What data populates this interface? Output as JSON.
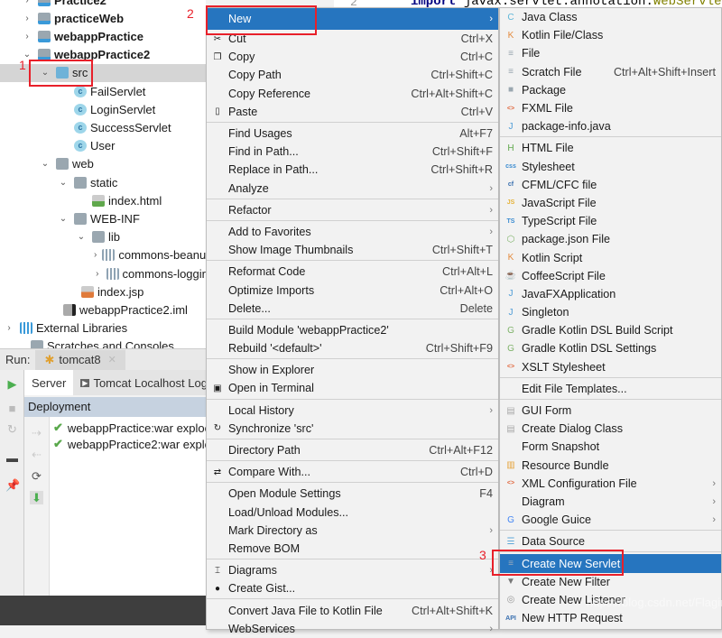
{
  "editor": {
    "line_number": "2",
    "code_keyword": "import",
    "code_package": " javax.servlet.annotation.",
    "code_class": "WebServlet",
    "code_end": ";"
  },
  "tree": {
    "items": [
      {
        "label": "Practice2",
        "depth": 1,
        "arrow": "›",
        "icon": "mod",
        "bold": true
      },
      {
        "label": "practiceWeb",
        "depth": 1,
        "arrow": "›",
        "icon": "mod",
        "bold": true
      },
      {
        "label": "webappPractice",
        "depth": 1,
        "arrow": "›",
        "icon": "mod",
        "bold": true
      },
      {
        "label": "webappPractice2",
        "depth": 1,
        "arrow": "⌄",
        "icon": "mod",
        "bold": true
      },
      {
        "label": "src",
        "depth": 2,
        "arrow": "⌄",
        "icon": "srcf",
        "selected": true
      },
      {
        "label": "FailServlet",
        "depth": 3,
        "arrow": "",
        "icon": "cls"
      },
      {
        "label": "LoginServlet",
        "depth": 3,
        "arrow": "",
        "icon": "cls"
      },
      {
        "label": "SuccessServlet",
        "depth": 3,
        "arrow": "",
        "icon": "cls"
      },
      {
        "label": "User",
        "depth": 3,
        "arrow": "",
        "icon": "cls"
      },
      {
        "label": "web",
        "depth": 2,
        "arrow": "⌄",
        "icon": "folder"
      },
      {
        "label": "static",
        "depth": 3,
        "arrow": "⌄",
        "icon": "folder"
      },
      {
        "label": "index.html",
        "depth": 4,
        "arrow": "",
        "icon": "html"
      },
      {
        "label": "WEB-INF",
        "depth": 3,
        "arrow": "⌄",
        "icon": "folder"
      },
      {
        "label": "lib",
        "depth": 4,
        "arrow": "⌄",
        "icon": "folder"
      },
      {
        "label": "commons-beanu",
        "depth": 5,
        "arrow": "›",
        "icon": "jar"
      },
      {
        "label": "commons-loggir",
        "depth": 5,
        "arrow": "›",
        "icon": "jar"
      },
      {
        "label": "index.jsp",
        "depth": 3.4,
        "arrow": "",
        "icon": "jsp"
      },
      {
        "label": "webappPractice2.iml",
        "depth": 2.4,
        "arrow": "",
        "icon": "iml"
      },
      {
        "label": "External Libraries",
        "depth": 0,
        "arrow": "›",
        "icon": "lib"
      },
      {
        "label": "Scratches and Consoles",
        "depth": 0.6,
        "arrow": "",
        "icon": "folder"
      }
    ]
  },
  "run": {
    "label": "Run:",
    "tab": "tomcat8",
    "subtabs": [
      "Server",
      "Tomcat Localhost Log"
    ],
    "deployment_header": "Deployment",
    "deployments": [
      "webappPractice:war exploc",
      "webappPractice2:war explo"
    ]
  },
  "context_menu": {
    "items": [
      {
        "label": "New",
        "shortcut": "",
        "submenu": true,
        "highlighted": true
      },
      {
        "label": "Cut",
        "shortcut": "Ctrl+X",
        "icon": "scissors-icon",
        "glyph": "✂"
      },
      {
        "label": "Copy",
        "shortcut": "Ctrl+C",
        "icon": "copy-icon",
        "glyph": "❐"
      },
      {
        "label": "Copy Path",
        "shortcut": "Ctrl+Shift+C"
      },
      {
        "label": "Copy Reference",
        "shortcut": "Ctrl+Alt+Shift+C"
      },
      {
        "label": "Paste",
        "shortcut": "Ctrl+V",
        "icon": "clipboard-icon",
        "glyph": "▯"
      },
      {
        "sep": true
      },
      {
        "label": "Find Usages",
        "shortcut": "Alt+F7"
      },
      {
        "label": "Find in Path...",
        "shortcut": "Ctrl+Shift+F"
      },
      {
        "label": "Replace in Path...",
        "shortcut": "Ctrl+Shift+R"
      },
      {
        "label": "Analyze",
        "submenu": true
      },
      {
        "sep": true
      },
      {
        "label": "Refactor",
        "submenu": true
      },
      {
        "sep": true
      },
      {
        "label": "Add to Favorites",
        "submenu": true
      },
      {
        "label": "Show Image Thumbnails",
        "shortcut": "Ctrl+Shift+T"
      },
      {
        "sep": true
      },
      {
        "label": "Reformat Code",
        "shortcut": "Ctrl+Alt+L"
      },
      {
        "label": "Optimize Imports",
        "shortcut": "Ctrl+Alt+O"
      },
      {
        "label": "Delete...",
        "shortcut": "Delete"
      },
      {
        "sep": true
      },
      {
        "label": "Build Module 'webappPractice2'"
      },
      {
        "label": "Rebuild '<default>'",
        "shortcut": "Ctrl+Shift+F9"
      },
      {
        "sep": true
      },
      {
        "label": "Show in Explorer"
      },
      {
        "label": "Open in Terminal",
        "icon": "terminal-icon",
        "glyph": "▣"
      },
      {
        "sep": true
      },
      {
        "label": "Local History",
        "submenu": true
      },
      {
        "label": "Synchronize 'src'",
        "icon": "sync-icon",
        "glyph": "↻"
      },
      {
        "sep": true
      },
      {
        "label": "Directory Path",
        "shortcut": "Ctrl+Alt+F12"
      },
      {
        "sep": true
      },
      {
        "label": "Compare With...",
        "shortcut": "Ctrl+D",
        "icon": "compare-icon",
        "glyph": "⇄"
      },
      {
        "sep": true
      },
      {
        "label": "Open Module Settings",
        "shortcut": "F4"
      },
      {
        "label": "Load/Unload Modules..."
      },
      {
        "label": "Mark Directory as",
        "submenu": true
      },
      {
        "label": "Remove BOM"
      },
      {
        "sep": true
      },
      {
        "label": "Diagrams",
        "submenu": true,
        "icon": "diagram-icon",
        "glyph": "⌶"
      },
      {
        "label": "Create Gist...",
        "icon": "github-icon",
        "glyph": "●"
      },
      {
        "sep": true
      },
      {
        "label": "Convert Java File to Kotlin File",
        "shortcut": "Ctrl+Alt+Shift+K"
      },
      {
        "label": "WebServices",
        "submenu": true
      }
    ]
  },
  "new_submenu": {
    "items": [
      {
        "label": "Java Class",
        "icon": "java-class-icon",
        "glyph": "C",
        "color": "#5fb7d9"
      },
      {
        "label": "Kotlin File/Class",
        "icon": "kotlin-icon",
        "glyph": "K",
        "color": "#e38a3d"
      },
      {
        "label": "File",
        "icon": "file-icon",
        "glyph": "≡",
        "color": "#9aa7b0"
      },
      {
        "label": "Scratch File",
        "shortcut": "Ctrl+Alt+Shift+Insert",
        "icon": "scratch-file-icon",
        "glyph": "≡",
        "color": "#9aa7b0"
      },
      {
        "label": "Package",
        "icon": "package-icon",
        "glyph": "■",
        "color": "#9aa7b0"
      },
      {
        "label": "FXML File",
        "icon": "fxml-icon",
        "glyph": "<>",
        "color": "#e0643a"
      },
      {
        "label": "package-info.java",
        "icon": "package-info-icon",
        "glyph": "J",
        "color": "#4a9ad6"
      },
      {
        "sep": true
      },
      {
        "label": "HTML File",
        "icon": "html-icon",
        "glyph": "H",
        "color": "#60a84c"
      },
      {
        "label": "Stylesheet",
        "icon": "css-icon",
        "glyph": "css",
        "color": "#3a8bd0"
      },
      {
        "label": "CFML/CFC file",
        "icon": "cfml-icon",
        "glyph": "cf",
        "color": "#3a70b0"
      },
      {
        "label": "JavaScript File",
        "icon": "javascript-icon",
        "glyph": "JS",
        "color": "#e5b33a"
      },
      {
        "label": "TypeScript File",
        "icon": "typescript-icon",
        "glyph": "TS",
        "color": "#3a8bd0"
      },
      {
        "label": "package.json File",
        "icon": "nodejs-icon",
        "glyph": "⬡",
        "color": "#7fb36a"
      },
      {
        "label": "Kotlin Script",
        "icon": "kotlin-script-icon",
        "glyph": "K",
        "color": "#e38a3d"
      },
      {
        "label": "CoffeeScript File",
        "icon": "coffeescript-icon",
        "glyph": "☕",
        "color": "#3a8bd0"
      },
      {
        "label": "JavaFXApplication",
        "icon": "javafx-icon",
        "glyph": "J",
        "color": "#4a9ad6"
      },
      {
        "label": "Singleton",
        "icon": "singleton-icon",
        "glyph": "J",
        "color": "#4a9ad6"
      },
      {
        "label": "Gradle Kotlin DSL Build Script",
        "icon": "gradle-icon",
        "glyph": "G",
        "color": "#7fb36a"
      },
      {
        "label": "Gradle Kotlin DSL Settings",
        "icon": "gradle-icon",
        "glyph": "G",
        "color": "#7fb36a"
      },
      {
        "label": "XSLT Stylesheet",
        "icon": "xslt-icon",
        "glyph": "<>",
        "color": "#e0643a"
      },
      {
        "sep": true
      },
      {
        "label": "Edit File Templates..."
      },
      {
        "sep": true
      },
      {
        "label": "GUI Form",
        "icon": "gui-form-icon",
        "glyph": "▤",
        "color": "#aaa"
      },
      {
        "label": "Create Dialog Class",
        "icon": "dialog-icon",
        "glyph": "▤",
        "color": "#aaa"
      },
      {
        "label": "Form Snapshot"
      },
      {
        "label": "Resource Bundle",
        "icon": "resource-bundle-icon",
        "glyph": "▥",
        "color": "#e5a33a"
      },
      {
        "label": "XML Configuration File",
        "submenu": true,
        "icon": "xml-icon",
        "glyph": "<>",
        "color": "#e0643a"
      },
      {
        "label": "Diagram",
        "submenu": true
      },
      {
        "label": "Google Guice",
        "submenu": true,
        "icon": "google-icon",
        "glyph": "G",
        "color": "#4285f4"
      },
      {
        "sep": true
      },
      {
        "label": "Data Source",
        "icon": "database-icon",
        "glyph": "☰",
        "color": "#5fa8d9"
      },
      {
        "sep": true
      },
      {
        "label": "Create New Servlet",
        "highlighted": true,
        "icon": "servlet-icon",
        "glyph": "≡",
        "color": "#9ab"
      },
      {
        "label": "Create New Filter",
        "icon": "filter-icon",
        "glyph": "▼",
        "color": "#777"
      },
      {
        "label": "Create New Listener",
        "icon": "listener-icon",
        "glyph": "◎",
        "color": "#999"
      },
      {
        "label": "New HTTP Request",
        "icon": "api-icon",
        "glyph": "API",
        "color": "#3a70b0"
      }
    ]
  },
  "annotations": {
    "step1": "1",
    "step2": "2",
    "step3": "3"
  },
  "watermark": "https://blog.csdn.net/Flagino",
  "colors": {
    "highlight": "#2675bf",
    "annotation": "#e8202a"
  }
}
